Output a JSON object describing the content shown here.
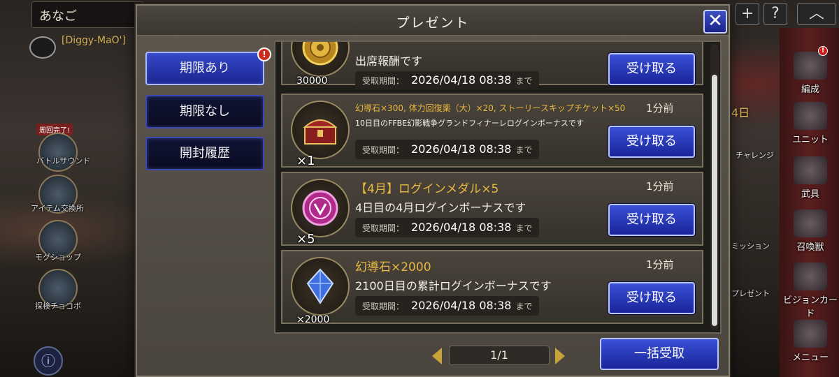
{
  "background": {
    "search_text": "あなご",
    "player_tag": "[Diggy-MaO']",
    "left_icons": [
      {
        "label": "周回完了!",
        "sub": "バトルサウンド"
      },
      {
        "label": "アイテム交換所"
      },
      {
        "label": "モグショップ"
      },
      {
        "label": "探検チョコボ"
      }
    ],
    "right_nav": [
      "編成",
      "ユニット",
      "武具",
      "召喚獣",
      "ビジョンカード",
      "メニュー"
    ],
    "mid_right_labels": [
      "チャレンジ",
      "ミッション",
      "プレゼント"
    ],
    "day_label": "4日"
  },
  "dialog": {
    "title": "プレゼント",
    "close_glyph": "✕",
    "tabs": [
      {
        "label": "期限あり",
        "active": true,
        "badge": "!"
      },
      {
        "label": "期限なし",
        "active": false
      },
      {
        "label": "開封履歴",
        "active": false
      }
    ],
    "period_label": "受取期間：",
    "period_suffix": "まで",
    "receive_label": "受け取る",
    "items": [
      {
        "title": "",
        "time_ago": "",
        "description": "出席報酬です",
        "deadline": "2026/04/18 08:38",
        "quantity": "30000",
        "icon": "gold-coin-icon"
      },
      {
        "title": "幻導石×300, 体力回復薬（大）×20, ストーリースキップチケット×50",
        "time_ago": "1分前",
        "description": "10日目のFFBE幻影戦争グランドフィナーレログインボーナスです",
        "deadline": "2026/04/18 08:38",
        "quantity": "×1",
        "icon": "treasure-chest-icon"
      },
      {
        "title": "【4月】ログインメダル×5",
        "time_ago": "1分前",
        "description": "4日目の4月ログインボーナスです",
        "deadline": "2026/04/18 08:38",
        "quantity": "×5",
        "icon": "login-medal-icon"
      },
      {
        "title": "幻導石×2000",
        "time_ago": "1分前",
        "description": "2100日目の累計ログインボーナスです",
        "deadline": "2026/04/18 08:38",
        "quantity": "×2000",
        "icon": "crystal-icon"
      }
    ],
    "pager": "1/1",
    "bulk_receive_label": "一括受取"
  },
  "colors": {
    "accent_blue": "#2a3bc0",
    "title_gold": "#e8b840",
    "badge_red": "#d02a1d"
  }
}
